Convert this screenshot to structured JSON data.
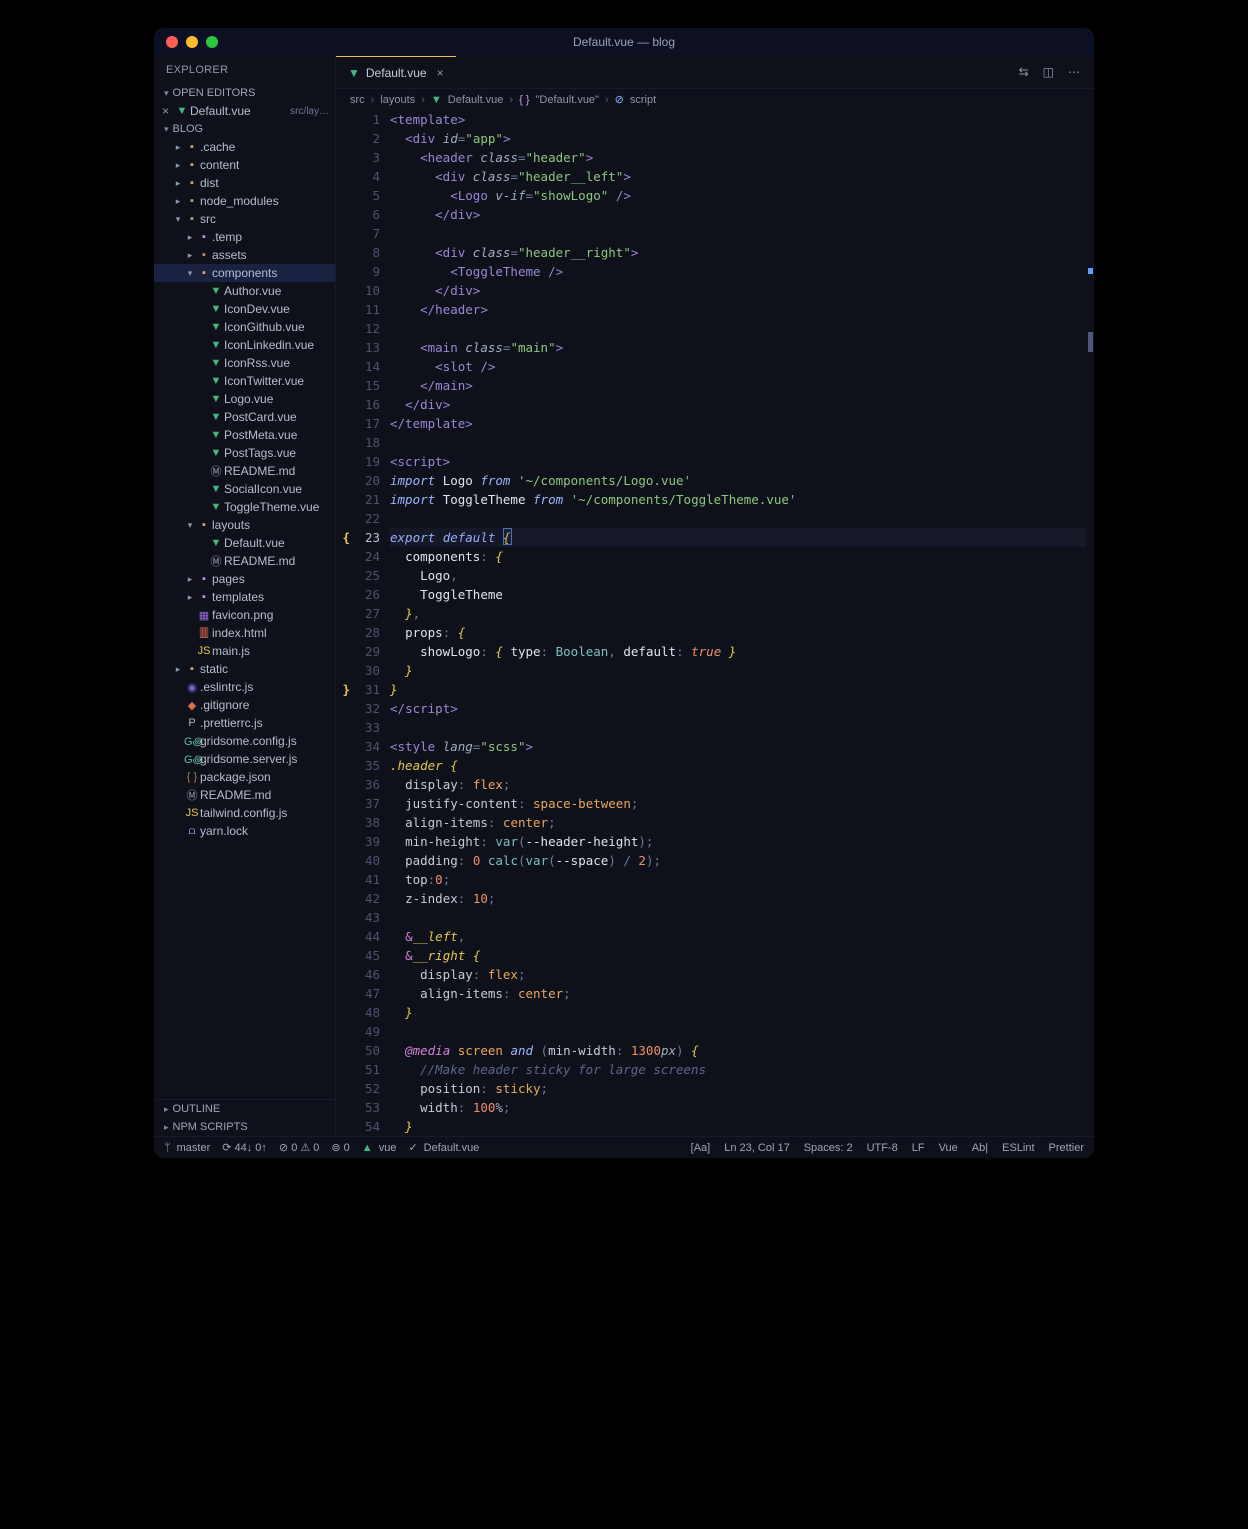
{
  "window": {
    "title": "Default.vue — blog"
  },
  "sidebar": {
    "header": "EXPLORER",
    "openEditors": {
      "label": "OPEN EDITORS",
      "items": [
        {
          "icon": "×",
          "file": "Default.vue",
          "path": "src/lay…"
        }
      ]
    },
    "project": {
      "label": "BLOG"
    },
    "tree": [
      {
        "d": 1,
        "t": "f",
        "ic": "folder",
        "exp": 0,
        "l": ".cache"
      },
      {
        "d": 1,
        "t": "f",
        "ic": "folder",
        "exp": 0,
        "l": "content"
      },
      {
        "d": 1,
        "t": "f",
        "ic": "folder",
        "exp": 0,
        "l": "dist"
      },
      {
        "d": 1,
        "t": "f",
        "ic": "folder-green",
        "exp": 0,
        "l": "node_modules"
      },
      {
        "d": 1,
        "t": "f",
        "ic": "folder-green",
        "exp": 1,
        "l": "src"
      },
      {
        "d": 2,
        "t": "f",
        "ic": "folder-purple",
        "exp": 0,
        "l": ".temp"
      },
      {
        "d": 2,
        "t": "f",
        "ic": "folder-red",
        "exp": 0,
        "l": "assets"
      },
      {
        "d": 2,
        "t": "f",
        "ic": "folder",
        "exp": 1,
        "l": "components",
        "sel": true
      },
      {
        "d": 3,
        "t": "i",
        "ic": "vue",
        "l": "Author.vue"
      },
      {
        "d": 3,
        "t": "i",
        "ic": "vue",
        "l": "IconDev.vue"
      },
      {
        "d": 3,
        "t": "i",
        "ic": "vue",
        "l": "IconGithub.vue"
      },
      {
        "d": 3,
        "t": "i",
        "ic": "vue",
        "l": "IconLinkedin.vue"
      },
      {
        "d": 3,
        "t": "i",
        "ic": "vue",
        "l": "IconRss.vue"
      },
      {
        "d": 3,
        "t": "i",
        "ic": "vue",
        "l": "IconTwitter.vue"
      },
      {
        "d": 3,
        "t": "i",
        "ic": "vue",
        "l": "Logo.vue"
      },
      {
        "d": 3,
        "t": "i",
        "ic": "vue",
        "l": "PostCard.vue"
      },
      {
        "d": 3,
        "t": "i",
        "ic": "vue",
        "l": "PostMeta.vue"
      },
      {
        "d": 3,
        "t": "i",
        "ic": "vue",
        "l": "PostTags.vue"
      },
      {
        "d": 3,
        "t": "i",
        "ic": "md",
        "l": "README.md"
      },
      {
        "d": 3,
        "t": "i",
        "ic": "vue",
        "l": "SocialIcon.vue"
      },
      {
        "d": 3,
        "t": "i",
        "ic": "vue",
        "l": "ToggleTheme.vue"
      },
      {
        "d": 2,
        "t": "f",
        "ic": "folder",
        "exp": 1,
        "l": "layouts"
      },
      {
        "d": 3,
        "t": "i",
        "ic": "vue",
        "l": "Default.vue"
      },
      {
        "d": 3,
        "t": "i",
        "ic": "md",
        "l": "README.md"
      },
      {
        "d": 2,
        "t": "f",
        "ic": "folder-purple",
        "exp": 0,
        "l": "pages"
      },
      {
        "d": 2,
        "t": "f",
        "ic": "folder-purple",
        "exp": 0,
        "l": "templates"
      },
      {
        "d": 2,
        "t": "i",
        "ic": "png",
        "l": "favicon.png"
      },
      {
        "d": 2,
        "t": "i",
        "ic": "html",
        "l": "index.html"
      },
      {
        "d": 2,
        "t": "i",
        "ic": "js",
        "l": "main.js"
      },
      {
        "d": 1,
        "t": "f",
        "ic": "folder",
        "exp": 0,
        "l": "static"
      },
      {
        "d": 1,
        "t": "i",
        "ic": "eslint",
        "l": ".eslintrc.js"
      },
      {
        "d": 1,
        "t": "i",
        "ic": "git",
        "l": ".gitignore"
      },
      {
        "d": 1,
        "t": "i",
        "ic": "pretty",
        "l": ".prettierrc.js"
      },
      {
        "d": 1,
        "t": "i",
        "ic": "gridsome",
        "l": "gridsome.config.js"
      },
      {
        "d": 1,
        "t": "i",
        "ic": "gridsome",
        "l": "gridsome.server.js"
      },
      {
        "d": 1,
        "t": "i",
        "ic": "json",
        "l": "package.json"
      },
      {
        "d": 1,
        "t": "i",
        "ic": "md",
        "l": "README.md"
      },
      {
        "d": 1,
        "t": "i",
        "ic": "js",
        "l": "tailwind.config.js"
      },
      {
        "d": 1,
        "t": "i",
        "ic": "lock",
        "l": "yarn.lock"
      }
    ],
    "outline": "OUTLINE",
    "npm": "NPM SCRIPTS"
  },
  "tab": {
    "file": "Default.vue"
  },
  "breadcrumbs": [
    "src",
    "layouts",
    "Default.vue",
    "\"Default.vue\"",
    "script"
  ],
  "code": {
    "lines": [
      [
        [
          "tag",
          "<template>"
        ]
      ],
      [
        [
          "pun",
          "  "
        ],
        [
          "tag",
          "<div"
        ],
        [
          "pun",
          " "
        ],
        [
          "attr",
          "id"
        ],
        [
          "pun",
          "="
        ],
        [
          "str",
          "\"app\""
        ],
        [
          "tag",
          ">"
        ]
      ],
      [
        [
          "pun",
          "    "
        ],
        [
          "tag",
          "<header"
        ],
        [
          "pun",
          " "
        ],
        [
          "attr",
          "class"
        ],
        [
          "pun",
          "="
        ],
        [
          "str",
          "\"header\""
        ],
        [
          "tag",
          ">"
        ]
      ],
      [
        [
          "pun",
          "      "
        ],
        [
          "tag",
          "<div"
        ],
        [
          "pun",
          " "
        ],
        [
          "attr",
          "class"
        ],
        [
          "pun",
          "="
        ],
        [
          "str",
          "\"header__left\""
        ],
        [
          "tag",
          ">"
        ]
      ],
      [
        [
          "pun",
          "        "
        ],
        [
          "tag",
          "<Logo"
        ],
        [
          "pun",
          " "
        ],
        [
          "attr",
          "v-if"
        ],
        [
          "pun",
          "="
        ],
        [
          "str",
          "\"showLogo\""
        ],
        [
          "pun",
          " "
        ],
        [
          "tag",
          "/>"
        ]
      ],
      [
        [
          "pun",
          "      "
        ],
        [
          "tag",
          "</div>"
        ]
      ],
      [],
      [
        [
          "pun",
          "      "
        ],
        [
          "tag",
          "<div"
        ],
        [
          "pun",
          " "
        ],
        [
          "attr",
          "class"
        ],
        [
          "pun",
          "="
        ],
        [
          "str",
          "\"header__right\""
        ],
        [
          "tag",
          ">"
        ]
      ],
      [
        [
          "pun",
          "        "
        ],
        [
          "tag",
          "<ToggleTheme"
        ],
        [
          "pun",
          " "
        ],
        [
          "tag",
          "/>"
        ]
      ],
      [
        [
          "pun",
          "      "
        ],
        [
          "tag",
          "</div>"
        ]
      ],
      [
        [
          "pun",
          "    "
        ],
        [
          "tag",
          "</header>"
        ]
      ],
      [],
      [
        [
          "pun",
          "    "
        ],
        [
          "tag",
          "<main"
        ],
        [
          "pun",
          " "
        ],
        [
          "attr",
          "class"
        ],
        [
          "pun",
          "="
        ],
        [
          "str",
          "\"main\""
        ],
        [
          "tag",
          ">"
        ]
      ],
      [
        [
          "pun",
          "      "
        ],
        [
          "tag",
          "<slot"
        ],
        [
          "pun",
          " "
        ],
        [
          "tag",
          "/>"
        ]
      ],
      [
        [
          "pun",
          "    "
        ],
        [
          "tag",
          "</main>"
        ]
      ],
      [
        [
          "pun",
          "  "
        ],
        [
          "tag",
          "</div>"
        ]
      ],
      [
        [
          "tag",
          "</template>"
        ]
      ],
      [],
      [
        [
          "tag",
          "<script>"
        ]
      ],
      [
        [
          "kw",
          "import"
        ],
        [
          "pun",
          " "
        ],
        [
          "white",
          "Logo"
        ],
        [
          "pun",
          " "
        ],
        [
          "kw",
          "from"
        ],
        [
          "pun",
          " "
        ],
        [
          "str",
          "'~/components/Logo.vue'"
        ]
      ],
      [
        [
          "kw",
          "import"
        ],
        [
          "pun",
          " "
        ],
        [
          "white",
          "ToggleTheme"
        ],
        [
          "pun",
          " "
        ],
        [
          "kw",
          "from"
        ],
        [
          "pun",
          " "
        ],
        [
          "str",
          "'~/components/ToggleTheme.vue'"
        ]
      ],
      [],
      [
        [
          "kw",
          "export"
        ],
        [
          "pun",
          " "
        ],
        [
          "kw",
          "default"
        ],
        [
          "pun",
          " "
        ],
        [
          "sel",
          "{"
        ]
      ],
      [
        [
          "pun",
          "  "
        ],
        [
          "white",
          "components"
        ],
        [
          "pun",
          ": "
        ],
        [
          "sel",
          "{"
        ]
      ],
      [
        [
          "pun",
          "    "
        ],
        [
          "white",
          "Logo"
        ],
        [
          "pun",
          ","
        ]
      ],
      [
        [
          "pun",
          "    "
        ],
        [
          "white",
          "ToggleTheme"
        ]
      ],
      [
        [
          "pun",
          "  "
        ],
        [
          "sel",
          "}"
        ],
        [
          "pun",
          ","
        ]
      ],
      [
        [
          "pun",
          "  "
        ],
        [
          "white",
          "props"
        ],
        [
          "pun",
          ": "
        ],
        [
          "sel",
          "{"
        ]
      ],
      [
        [
          "pun",
          "    "
        ],
        [
          "white",
          "showLogo"
        ],
        [
          "pun",
          ": "
        ],
        [
          "sel",
          "{"
        ],
        [
          "pun",
          " "
        ],
        [
          "white",
          "type"
        ],
        [
          "pun",
          ": "
        ],
        [
          "id",
          "Boolean"
        ],
        [
          "pun",
          ", "
        ],
        [
          "white",
          "default"
        ],
        [
          "pun",
          ": "
        ],
        [
          "bool",
          "true"
        ],
        [
          "pun",
          " "
        ],
        [
          "sel",
          "}"
        ]
      ],
      [
        [
          "pun",
          "  "
        ],
        [
          "sel",
          "}"
        ]
      ],
      [
        [
          "sel",
          "}"
        ]
      ],
      [
        [
          "tag",
          "</"
        ],
        [
          "tag",
          "script>"
        ]
      ],
      [],
      [
        [
          "tag",
          "<style"
        ],
        [
          "pun",
          " "
        ],
        [
          "attr",
          "lang"
        ],
        [
          "pun",
          "="
        ],
        [
          "str",
          "\"scss\""
        ],
        [
          "tag",
          ">"
        ]
      ],
      [
        [
          "sel",
          ".header"
        ],
        [
          "pun",
          " "
        ],
        [
          "sel",
          "{"
        ]
      ],
      [
        [
          "pun",
          "  "
        ],
        [
          "css",
          "display"
        ],
        [
          "pun",
          ": "
        ],
        [
          "cv",
          "flex"
        ],
        [
          "pun",
          ";"
        ]
      ],
      [
        [
          "pun",
          "  "
        ],
        [
          "css",
          "justify-content"
        ],
        [
          "pun",
          ": "
        ],
        [
          "cv",
          "space-between"
        ],
        [
          "pun",
          ";"
        ]
      ],
      [
        [
          "pun",
          "  "
        ],
        [
          "css",
          "align-items"
        ],
        [
          "pun",
          ": "
        ],
        [
          "cv",
          "center"
        ],
        [
          "pun",
          ";"
        ]
      ],
      [
        [
          "pun",
          "  "
        ],
        [
          "css",
          "min-height"
        ],
        [
          "pun",
          ": "
        ],
        [
          "id",
          "var"
        ],
        [
          "pun",
          "("
        ],
        [
          "white",
          "--header-height"
        ],
        [
          "pun",
          ");"
        ]
      ],
      [
        [
          "pun",
          "  "
        ],
        [
          "css",
          "padding"
        ],
        [
          "pun",
          ": "
        ],
        [
          "num",
          "0"
        ],
        [
          "pun",
          " "
        ],
        [
          "id",
          "calc"
        ],
        [
          "pun",
          "("
        ],
        [
          "id",
          "var"
        ],
        [
          "pun",
          "("
        ],
        [
          "white",
          "--space"
        ],
        [
          "pun",
          ") / "
        ],
        [
          "num",
          "2"
        ],
        [
          "pun",
          ");"
        ]
      ],
      [
        [
          "pun",
          "  "
        ],
        [
          "css",
          "top"
        ],
        [
          "pun",
          ":"
        ],
        [
          "num",
          "0"
        ],
        [
          "pun",
          ";"
        ]
      ],
      [
        [
          "pun",
          "  "
        ],
        [
          "css",
          "z-index"
        ],
        [
          "pun",
          ": "
        ],
        [
          "num",
          "10"
        ],
        [
          "pun",
          ";"
        ]
      ],
      [],
      [
        [
          "pun",
          "  "
        ],
        [
          "amp",
          "&"
        ],
        [
          "sel",
          "__left"
        ],
        [
          "pun",
          ","
        ]
      ],
      [
        [
          "pun",
          "  "
        ],
        [
          "amp",
          "&"
        ],
        [
          "sel",
          "__right"
        ],
        [
          "pun",
          " "
        ],
        [
          "sel",
          "{"
        ]
      ],
      [
        [
          "pun",
          "    "
        ],
        [
          "css",
          "display"
        ],
        [
          "pun",
          ": "
        ],
        [
          "cv",
          "flex"
        ],
        [
          "pun",
          ";"
        ]
      ],
      [
        [
          "pun",
          "    "
        ],
        [
          "css",
          "align-items"
        ],
        [
          "pun",
          ": "
        ],
        [
          "cv",
          "center"
        ],
        [
          "pun",
          ";"
        ]
      ],
      [
        [
          "pun",
          "  "
        ],
        [
          "sel",
          "}"
        ]
      ],
      [],
      [
        [
          "pun",
          "  "
        ],
        [
          "at",
          "@media"
        ],
        [
          "pun",
          " "
        ],
        [
          "cv",
          "screen"
        ],
        [
          "pun",
          " "
        ],
        [
          "kw",
          "and"
        ],
        [
          "pun",
          " ("
        ],
        [
          "css",
          "min-width"
        ],
        [
          "pun",
          ": "
        ],
        [
          "num",
          "1300"
        ],
        [
          "attr",
          "px"
        ],
        [
          "pun",
          ") "
        ],
        [
          "sel",
          "{"
        ]
      ],
      [
        [
          "pun",
          "    "
        ],
        [
          "com",
          "//Make header sticky for large screens"
        ]
      ],
      [
        [
          "pun",
          "    "
        ],
        [
          "css",
          "position"
        ],
        [
          "pun",
          ": "
        ],
        [
          "cv",
          "sticky"
        ],
        [
          "pun",
          ";"
        ]
      ],
      [
        [
          "pun",
          "    "
        ],
        [
          "css",
          "width"
        ],
        [
          "pun",
          ": "
        ],
        [
          "num",
          "100"
        ],
        [
          "attr",
          "%"
        ],
        [
          "pun",
          ";"
        ]
      ],
      [
        [
          "pun",
          "  "
        ],
        [
          "sel",
          "}"
        ]
      ],
      [
        [
          "sel",
          "}"
        ]
      ]
    ],
    "currentLine": 23,
    "gutterMarks": {
      "23": "{",
      "31": "}"
    }
  },
  "status": {
    "branch": "master",
    "sync": "⟳ 44↓ 0↑",
    "problems": "⊘ 0 ⚠ 0",
    "tests": "⊚ 0",
    "lang": "vue",
    "file": "Default.vue",
    "aa": "[Aa]",
    "pos": "Ln 23, Col 17",
    "spaces": "Spaces: 2",
    "enc": "UTF-8",
    "eol": "LF",
    "mode": "Vue",
    "ab": "Ab|",
    "eslint": "ESLint",
    "prettier": "Prettier"
  }
}
